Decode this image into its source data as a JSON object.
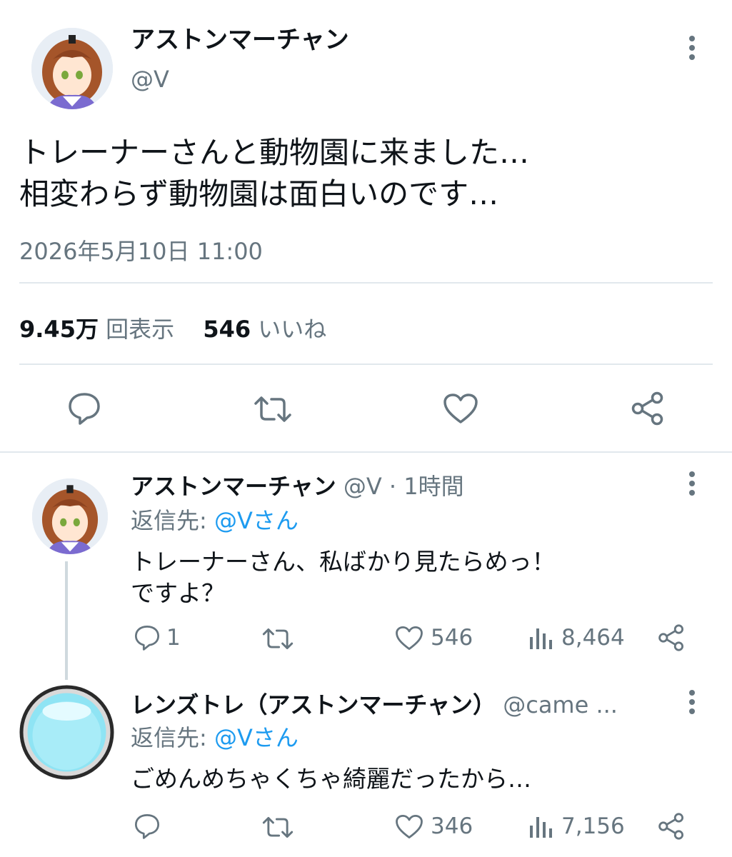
{
  "main_tweet": {
    "display_name": "アストンマーチャン",
    "handle": "@V",
    "text_line1": "トレーナーさんと動物園に来ました…",
    "text_line2": "相変わらず動物園は面白いのです…",
    "timestamp": "2026年5月10日 11:00",
    "views_value": "9.45万",
    "views_label": "回表示",
    "likes_value": "546",
    "likes_label": "いいね"
  },
  "reply1": {
    "display_name": "アストンマーチャン",
    "handle": "@V",
    "sep": "·",
    "time": "1時間",
    "reply_to_prefix": "返信先:",
    "reply_to_user": "@Vさん",
    "text_line1": "トレーナーさん、私ばかり見たらめっ！",
    "text_line2": "ですよ？",
    "reply_count": "1",
    "like_count": "546",
    "view_count": "8,464"
  },
  "reply2": {
    "display_name": "レンズトレ（アストンマーチャン）",
    "handle": "@came ...",
    "reply_to_prefix": "返信先:",
    "reply_to_user": "@Vさん",
    "text_line1": "ごめんめちゃくちゃ綺麗だったから…",
    "like_count": "346",
    "view_count": "7,156"
  },
  "icons": [
    "more-icon",
    "reply-icon",
    "retweet-icon",
    "like-icon",
    "share-icon",
    "views-icon"
  ],
  "colors": {
    "text": "#0f1419",
    "secondary": "#66757f",
    "link": "#1d9bf0",
    "divider": "#e1e8ed",
    "thread_line": "#cfd9de"
  }
}
